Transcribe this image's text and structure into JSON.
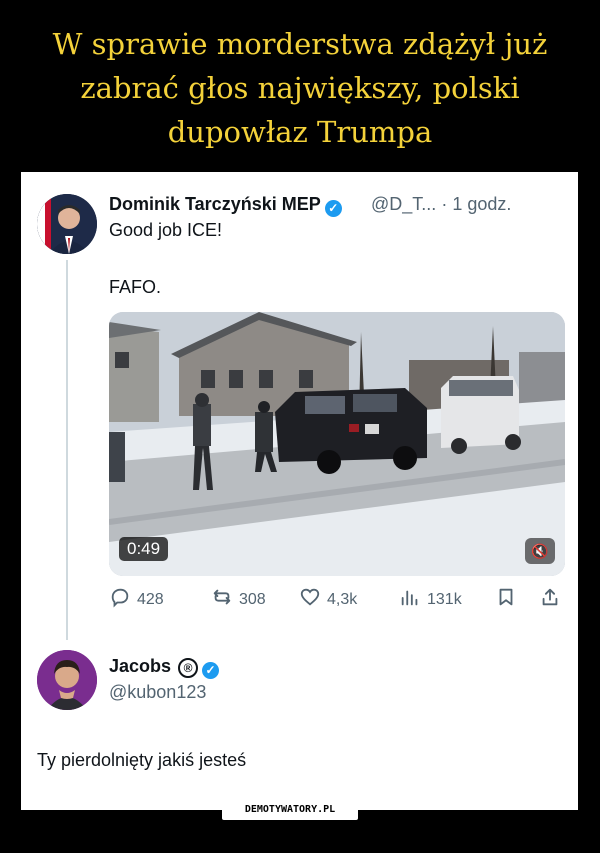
{
  "header": {
    "title": "W sprawie morderstwa zdążył już zabrać głos największy, polski dupowłaz Trumpa"
  },
  "tweet": {
    "author": "Dominik Tarczyński MEP",
    "handle": "@D_T...",
    "separator": "·",
    "time": "1 godz.",
    "text_line1": "Good job ICE!",
    "text_line2": "FAFO.",
    "video_time": "0:49",
    "stats": {
      "replies": "428",
      "reposts": "308",
      "likes": "4,3k",
      "views": "131k"
    }
  },
  "reply": {
    "author": "Jacobs",
    "registered_mark": "®",
    "handle": "@kubon123",
    "text": "Ty pierdolnięty jakiś jesteś"
  },
  "footer": {
    "watermark": "DEMOTYWATORY.PL"
  },
  "colors": {
    "title": "#f4d23a",
    "verified": "#1d9bf0",
    "muted": "#536471"
  },
  "icons": [
    "verified-badge-icon",
    "reply-icon",
    "repost-icon",
    "like-icon",
    "views-icon",
    "bookmark-icon",
    "share-icon",
    "mute-icon"
  ]
}
